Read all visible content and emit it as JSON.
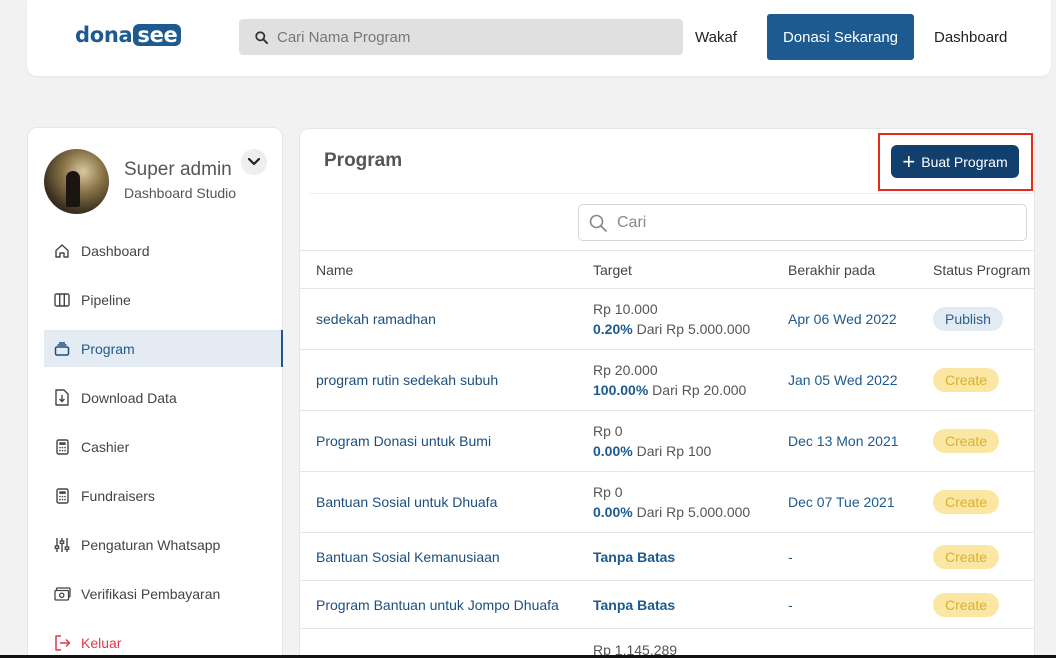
{
  "header": {
    "logo_part1": "dona",
    "logo_part2": "see",
    "search_placeholder": "Cari Nama Program",
    "nav_wakaf": "Wakaf",
    "donate_button": "Donasi Sekarang",
    "nav_dashboard": "Dashboard"
  },
  "sidebar": {
    "user_name": "Super admin",
    "user_subtitle": "Dashboard Studio",
    "items": [
      {
        "label": "Dashboard",
        "icon": "home-icon"
      },
      {
        "label": "Pipeline",
        "icon": "columns-icon"
      },
      {
        "label": "Program",
        "icon": "stack-icon",
        "active": true
      },
      {
        "label": "Download Data",
        "icon": "download-file-icon"
      },
      {
        "label": "Cashier",
        "icon": "calculator-icon"
      },
      {
        "label": "Fundraisers",
        "icon": "calculator-icon"
      },
      {
        "label": "Pengaturan Whatsapp",
        "icon": "sliders-icon"
      },
      {
        "label": "Verifikasi Pembayaran",
        "icon": "money-icon"
      },
      {
        "label": "Keluar",
        "icon": "logout-icon"
      }
    ]
  },
  "main": {
    "title": "Program",
    "create_button": "Buat Program",
    "search_placeholder": "Cari",
    "columns": [
      "Name",
      "Target",
      "Berakhir pada",
      "Status Program"
    ],
    "rows": [
      {
        "name": "sedekah ramadhan",
        "amount": "Rp 10.000",
        "pct": "0.20%",
        "of": " Dari Rp 5.000.000",
        "date": "Apr 06 Wed 2022",
        "status": "Publish"
      },
      {
        "name": "program rutin sedekah subuh",
        "amount": "Rp 20.000",
        "pct": "100.00%",
        "of": " Dari Rp 20.000",
        "date": "Jan 05 Wed 2022",
        "status": "Create"
      },
      {
        "name": "Program Donasi untuk Bumi",
        "amount": "Rp 0",
        "pct": "0.00%",
        "of": " Dari Rp 100",
        "date": "Dec 13 Mon 2021",
        "status": "Create"
      },
      {
        "name": "Bantuan Sosial untuk Dhuafa",
        "amount": "Rp 0",
        "pct": "0.00%",
        "of": " Dari Rp 5.000.000",
        "date": "Dec 07 Tue 2021",
        "status": "Create"
      },
      {
        "name": "Bantuan Sosial Kemanusiaan",
        "nolimit": "Tanpa Batas",
        "date": "-",
        "status": "Create"
      },
      {
        "name": "Program Bantuan untuk Jompo Dhuafa",
        "nolimit": "Tanpa Batas",
        "date": "-",
        "status": "Create"
      },
      {
        "amount": "Rp 1.145.289"
      }
    ]
  }
}
